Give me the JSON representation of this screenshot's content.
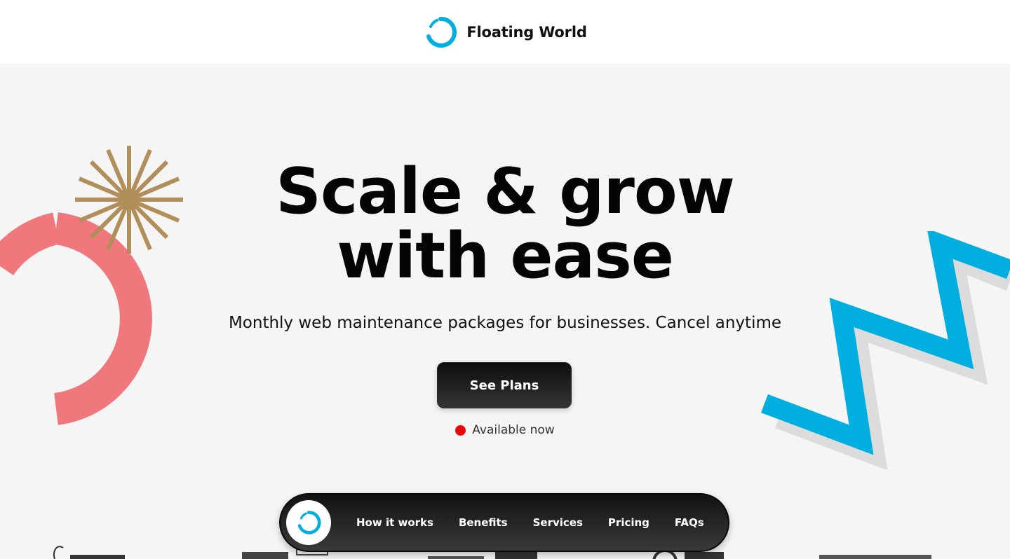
{
  "header": {
    "brand_name": "Floating World",
    "logo_icon": "blue-ring-logo-icon"
  },
  "hero": {
    "title_line1": "Scale & grow",
    "title_line2": "with ease",
    "subtitle": "Monthly web maintenance packages for businesses. Cancel anytime",
    "cta_label": "See Plans",
    "availability_text": "Available now"
  },
  "navbar": {
    "items": [
      {
        "label": "How it works"
      },
      {
        "label": "Benefits"
      },
      {
        "label": "Services"
      },
      {
        "label": "Pricing"
      },
      {
        "label": "FAQs"
      }
    ]
  },
  "colors": {
    "background": "#f5f5f5",
    "accent_blue": "#00aee0",
    "coral": "#f0787c",
    "gold": "#b28f5a",
    "status_red": "#e80a0a"
  }
}
